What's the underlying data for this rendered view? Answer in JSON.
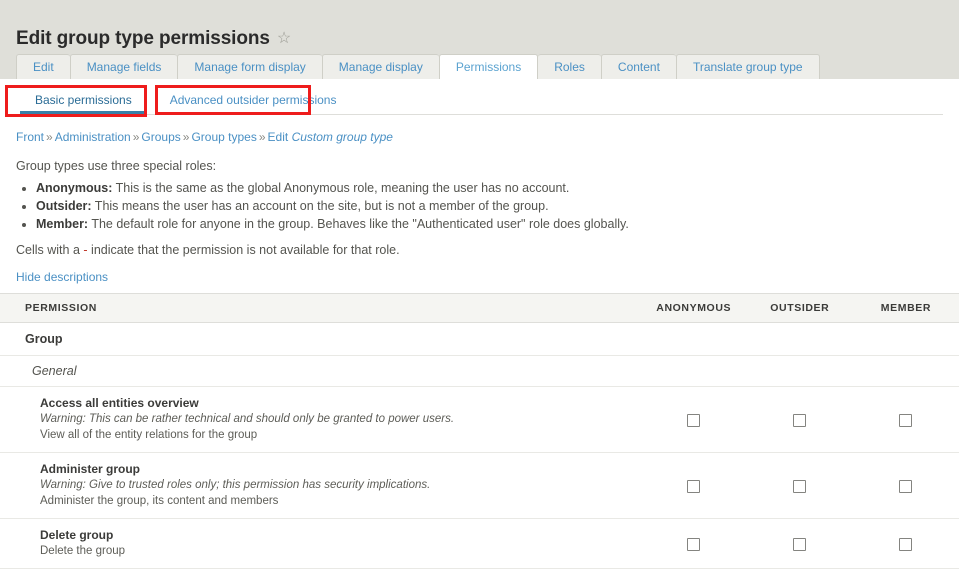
{
  "page": {
    "title": "Edit group type permissions",
    "star_icon": "star-outline-icon"
  },
  "primary_tabs": [
    {
      "label": "Edit",
      "active": false
    },
    {
      "label": "Manage fields",
      "active": false
    },
    {
      "label": "Manage form display",
      "active": false
    },
    {
      "label": "Manage display",
      "active": false
    },
    {
      "label": "Permissions",
      "active": true
    },
    {
      "label": "Roles",
      "active": false
    },
    {
      "label": "Content",
      "active": false
    },
    {
      "label": "Translate group type",
      "active": false
    }
  ],
  "secondary_tabs": [
    {
      "label": "Basic permissions",
      "active": true,
      "highlighted": true
    },
    {
      "label": "Advanced outsider permissions",
      "active": false,
      "highlighted": true
    }
  ],
  "breadcrumb": {
    "items": [
      {
        "label": "Front",
        "italic": false
      },
      {
        "label": "Administration",
        "italic": false
      },
      {
        "label": "Groups",
        "italic": false
      },
      {
        "label": "Group types",
        "italic": false
      },
      {
        "label": "Edit",
        "italic": false
      },
      {
        "label": "Custom group type",
        "italic": true
      }
    ],
    "separator": "»"
  },
  "intro": {
    "lead": "Group types use three special roles:",
    "roles": [
      {
        "name": "Anonymous:",
        "desc": " This is the same as the global Anonymous role, meaning the user has no account."
      },
      {
        "name": "Outsider:",
        "desc": " This means the user has an account on the site, but is not a member of the group."
      },
      {
        "name": "Member:",
        "desc": " The default role for anyone in the group. Behaves like the \"Authenticated user\" role does globally."
      }
    ],
    "cells_note_before": "Cells with a ",
    "cells_note_dash": "-",
    "cells_note_after": " indicate that the permission is not available for that role.",
    "hide_descriptions": "Hide descriptions"
  },
  "table": {
    "headers": {
      "permission": "PERMISSION",
      "anonymous": "ANONYMOUS",
      "outsider": "OUTSIDER",
      "member": "MEMBER"
    },
    "module": "Group",
    "section": "General",
    "rows": [
      {
        "title": "Access all entities overview",
        "warning": "Warning: This can be rather technical and should only be granted to power users.",
        "desc": "View all of the entity relations for the group",
        "anonymous": false,
        "outsider": false,
        "member": false
      },
      {
        "title": "Administer group",
        "warning": "Warning: Give to trusted roles only; this permission has security implications.",
        "desc": "Administer the group, its content and members",
        "anonymous": false,
        "outsider": false,
        "member": false
      },
      {
        "title": "Delete group",
        "warning": "",
        "desc": "Delete the group",
        "anonymous": false,
        "outsider": false,
        "member": false
      }
    ]
  },
  "colors": {
    "header_band": "#dfdfd9",
    "link": "#4a90c4",
    "annotation": "#ee1c1c",
    "active_underline": "#3980a8",
    "table_header_bg": "#f5f5f2"
  }
}
